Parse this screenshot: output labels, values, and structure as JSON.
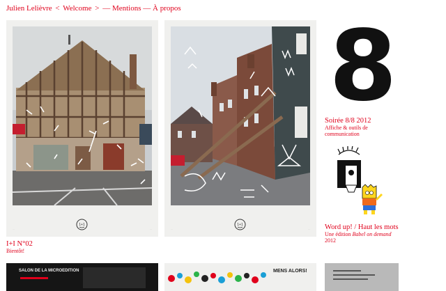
{
  "nav": {
    "name": "Julien Lelièvre",
    "lt": "<",
    "welcome": "Welcome",
    "gt": ">",
    "dash1": "—",
    "mentions": "Mentions",
    "dash2": "—",
    "apropos": "À propos"
  },
  "posters": [
    {
      "footer_left": "…",
      "footer_right": "…"
    },
    {
      "footer_left": "…",
      "footer_right": "…"
    }
  ],
  "poster_logo": "1+1",
  "big_number": "8",
  "projects": [
    {
      "title": "Soirée 8/8 2012",
      "sub1": "Affiche & outils de",
      "sub2": "communication"
    },
    {
      "title": "Word up! / Haut les mots",
      "sub1_a": "Une édition ",
      "sub1_em": "Babel on demand",
      "sub2": "2012"
    },
    {
      "title": "I+I N°02",
      "sub1": "Bientôt!"
    }
  ],
  "thumbs": {
    "t1_text": "SALON DE LA MICROEDITION",
    "t3_text": "MENS ALORS!"
  },
  "colors": {
    "accent": "#e0001b",
    "poster_bg": "#f0f0ee"
  }
}
